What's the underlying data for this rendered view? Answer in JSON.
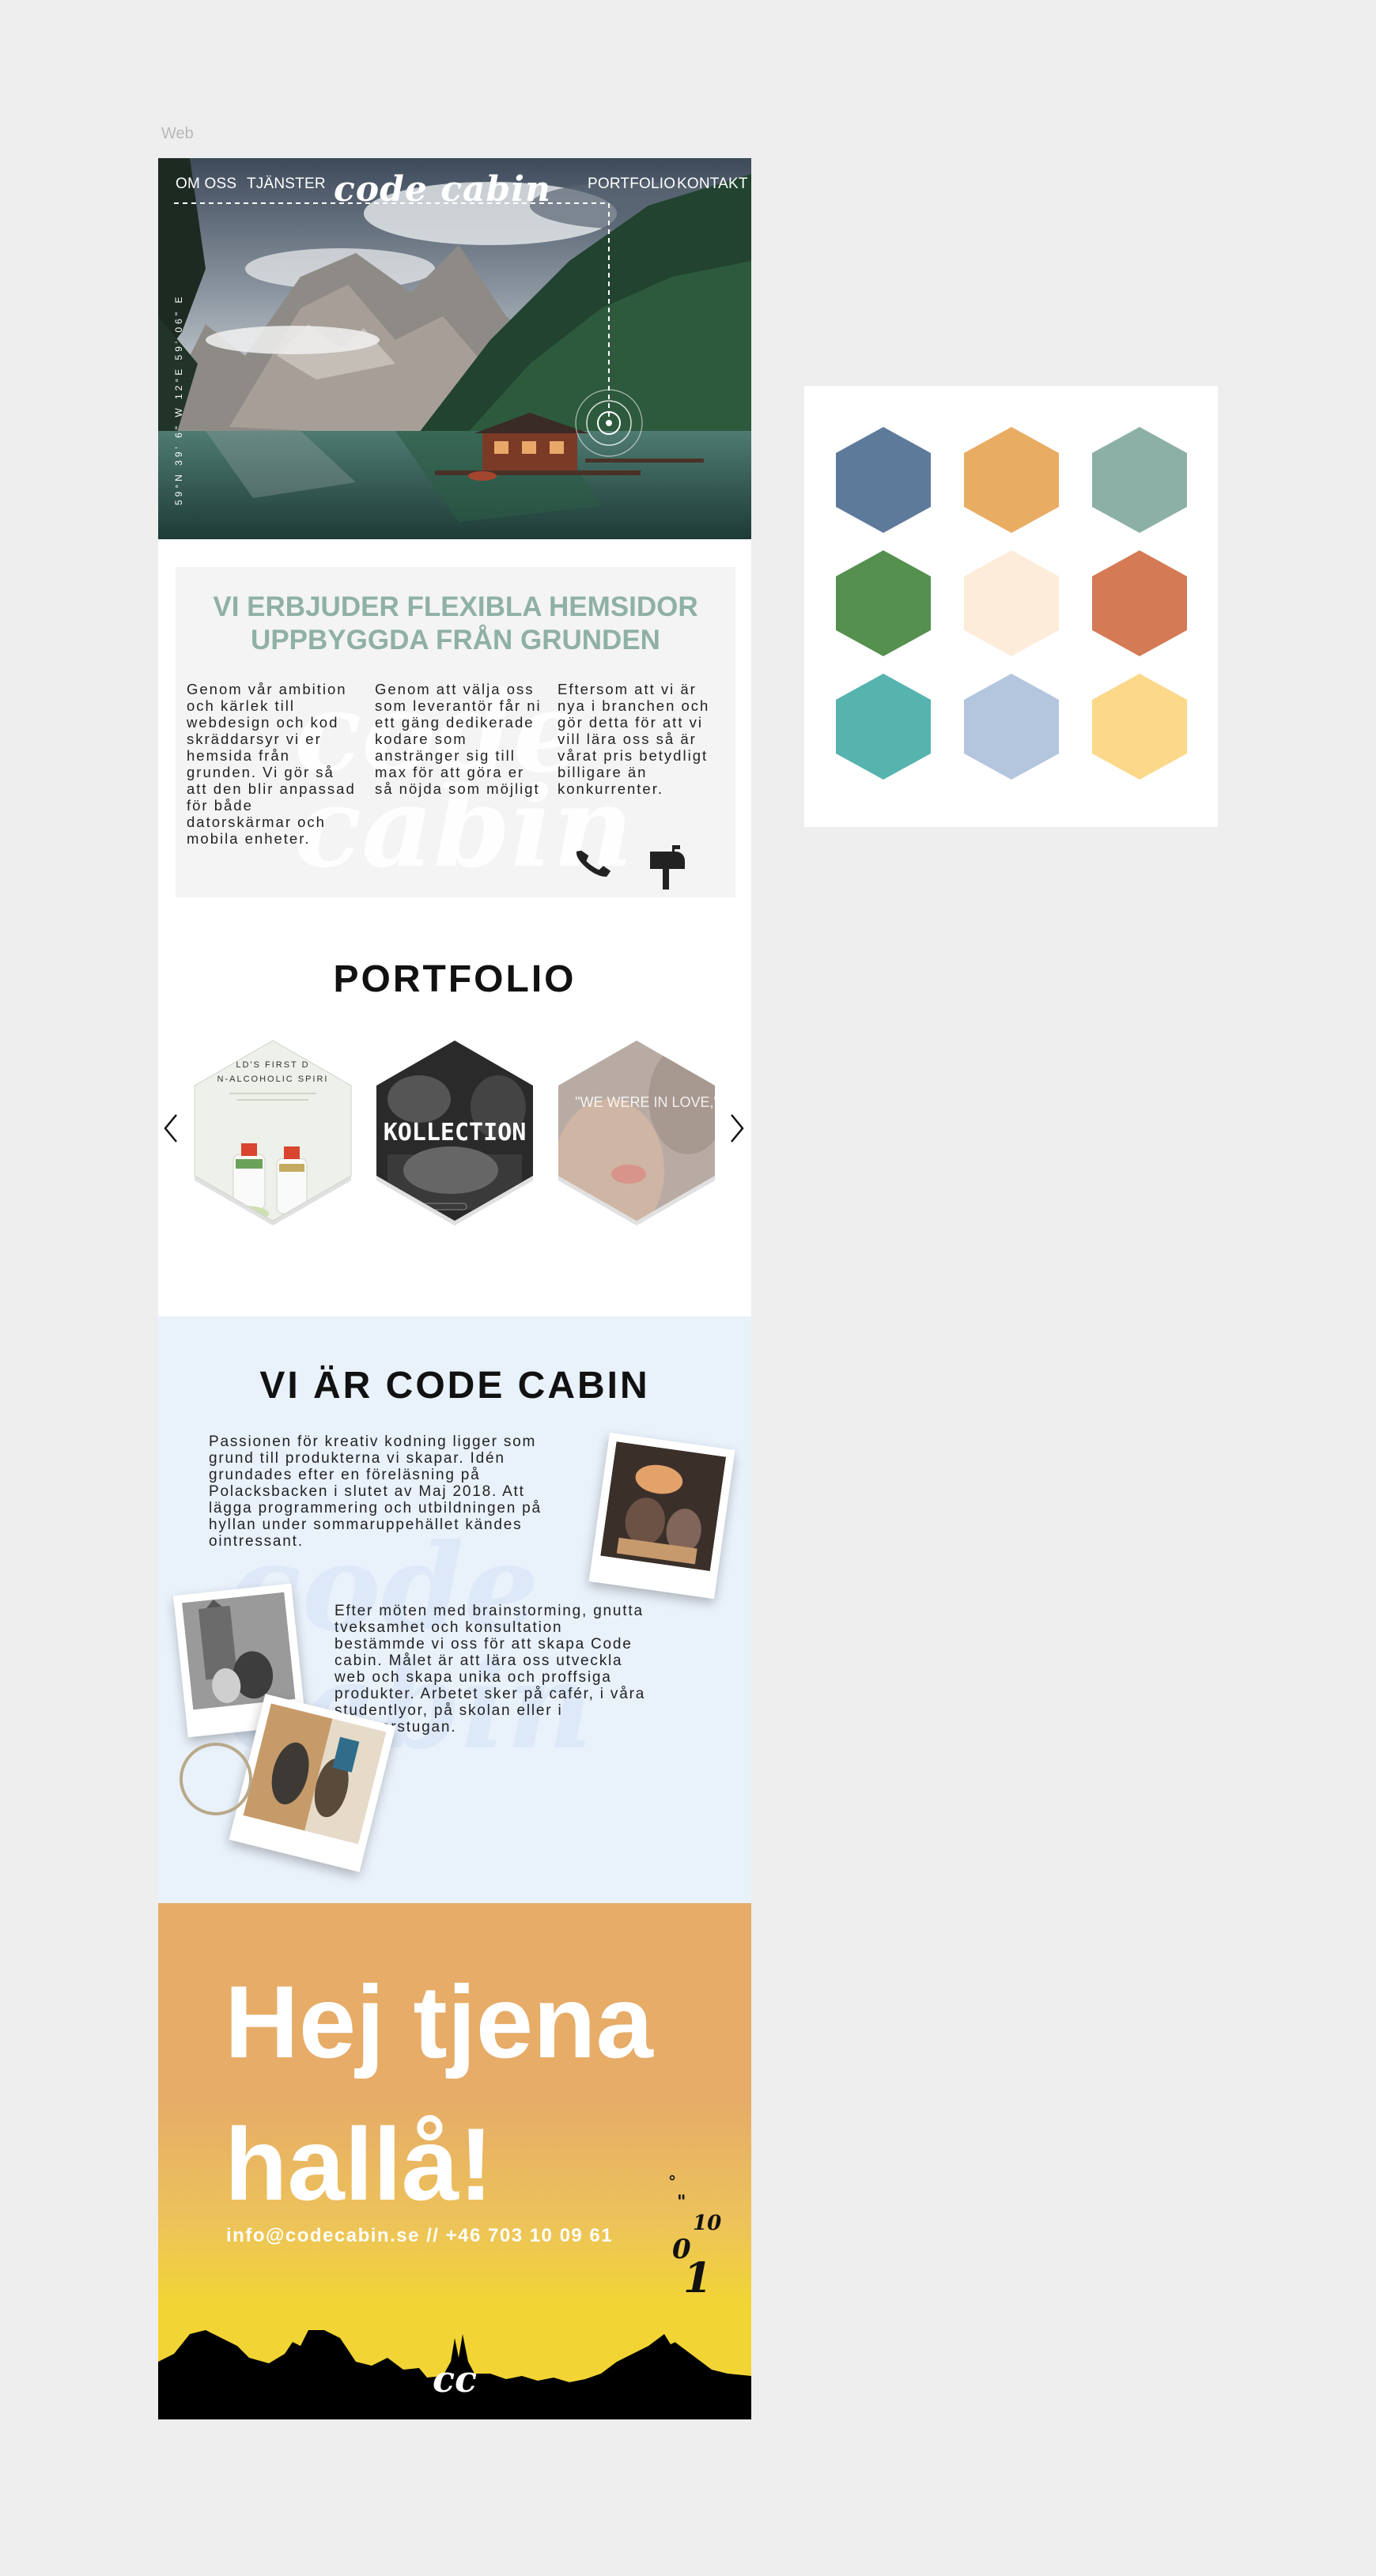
{
  "artboard": {
    "label": "Web"
  },
  "nav": {
    "left": [
      "OM OSS",
      "TJÄNSTER"
    ],
    "right": [
      "PORTFOLIO",
      "KONTAKT"
    ],
    "logo": "code cabin"
  },
  "hero": {
    "coordinates": "59°N 39' 6\" W 12°E 59' 06\" E"
  },
  "intro": {
    "title_line1": "VI ERBJUDER FLEXIBLA HEMSIDOR",
    "title_line2": "UPPBYGGDA FRÅN GRUNDEN",
    "watermark": "code cabin",
    "col1": "Genom vår ambition och kärlek till webdesign och kod skräddarsyr vi er hemsida från grunden. Vi gör så att den blir anpassad för både datorskärmar och mobila enheter.",
    "col2": "Genom att välja oss som leverantör får ni ett gäng dedikerade kodare som anstränger sig till max för att göra er så nöjda som möjligt",
    "col3": "Eftersom att vi är nya i branchen och gör detta för att vi vill lära oss så är vårat pris betydligt billigare än konkurrenter.",
    "icons": [
      "phone-icon",
      "mailbox-icon"
    ]
  },
  "portfolio": {
    "title": "PORTFOLIO",
    "items": [
      {
        "name": "spirit",
        "line1": "LD'S FIRST D",
        "line2": "N-ALCOHOLIC SPIRI"
      },
      {
        "name": "kollection",
        "text": "KOLLECTION"
      },
      {
        "name": "love",
        "text": "\"WE WERE IN LOVE,\""
      }
    ]
  },
  "about": {
    "title": "VI ÄR CODE CABIN",
    "watermark": "code cabin",
    "p1": "Passionen för kreativ kodning ligger som grund till produkterna vi skapar. Idén grundades efter en föreläsning på Polacksbacken i slutet av Maj 2018. Att lägga programmering och utbildningen på hyllan under sommaruppehället kändes ointressant.",
    "p2": "Efter möten med brainstorming, gnutta tveksamhet och konsultation bestämmde vi oss för att skapa Code cabin. Målet är att lära oss utveckla web och skapa unika och proffsiga produkter. Arbetet sker på cafér, i våra studentlyor, på skolan eller i sommarstugan."
  },
  "contact": {
    "line1": "Hej tjena",
    "line2": "hallå!",
    "info": "info@codecabin.se // +46 703 10 09 61",
    "logo": "cc",
    "binary": [
      "°",
      "\"",
      "10",
      "0",
      "1"
    ]
  },
  "palette": {
    "colors": [
      "#5e7a9b",
      "#e8ac63",
      "#8cb0a6",
      "#55904f",
      "#fdecd9",
      "#d47a55",
      "#57b3ad",
      "#b4c6de",
      "#fbd88a"
    ]
  }
}
